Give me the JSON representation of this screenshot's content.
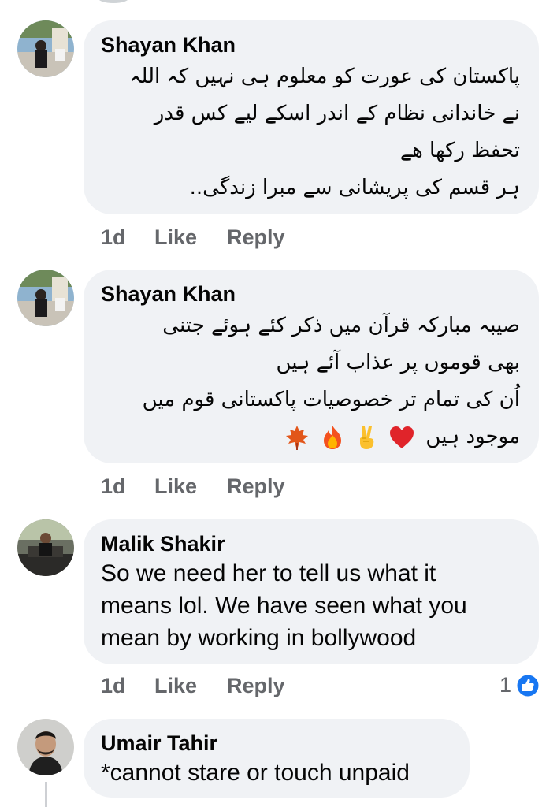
{
  "comments": [
    {
      "author": "Shayan Khan",
      "lines": [
        "پاکستان کی عورت کو معلوم ہی نہیں کہ اللہ",
        "نے خاندانی نظام کے اندر اسکے لیے کس قدر",
        "تحفظ رکھا ھے",
        "ہر قسم کی پریشانی سے مبرا زندگی.."
      ],
      "time": "1d",
      "like_label": "Like",
      "reply_label": "Reply"
    },
    {
      "author": "Shayan Khan",
      "lines": [
        "صیبہ مبارکہ قرآن میں ذکر کئے ہوئے جتنی",
        "بھی قوموں پر عذاب آئے ہیں",
        "اُن کی تمام تر خصوصیات پاکستانی قوم میں",
        "موجود ہیں"
      ],
      "emojis": [
        "heart-emoji",
        "victory-hand-emoji",
        "fire-emoji",
        "maple-leaf-emoji"
      ],
      "time": "1d",
      "like_label": "Like",
      "reply_label": "Reply"
    },
    {
      "author": "Malik Shakir",
      "lines": [
        "So we need her to tell us what it",
        "means lol. We have seen what you",
        "mean by working in bollywood"
      ],
      "time": "1d",
      "like_label": "Like",
      "reply_label": "Reply",
      "reaction_count": "1",
      "reaction_icon": "thumbs-up-icon"
    },
    {
      "author": "Umair Tahir",
      "lines": [
        "*cannot stare or touch unpaid"
      ]
    }
  ],
  "colors": {
    "bubble": "#f0f2f5",
    "meta_text": "#65676b",
    "like_blue": "#1877f2"
  }
}
